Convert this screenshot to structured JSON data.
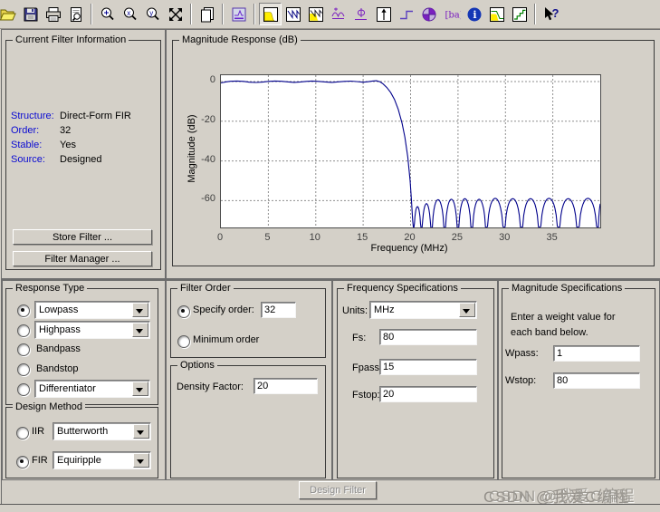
{
  "toolbar": {
    "icons": [
      "open",
      "save",
      "print",
      "print-preview",
      "zoom-in",
      "zoom-x",
      "zoom-y",
      "full-view",
      "print-to-figure",
      "filter-design",
      "magnitude-response",
      "phase-response",
      "magnitude-and-phase",
      "group-delay",
      "phase-delay",
      "impulse-response",
      "step-response",
      "pole-zero",
      "filter-coefficients",
      "filter-information",
      "magnitude-response-estimate",
      "realize-model",
      "help"
    ],
    "active_icon": "magnitude-response"
  },
  "current_filter_info": {
    "title": "Current Filter Information",
    "fields": [
      {
        "label": "Structure:",
        "value": "Direct-Form FIR"
      },
      {
        "label": "Order:",
        "value": "32"
      },
      {
        "label": "Stable:",
        "value": "Yes"
      },
      {
        "label": "Source:",
        "value": "Designed"
      }
    ],
    "store_filter_button": "Store Filter ...",
    "filter_manager_button": "Filter Manager ..."
  },
  "chart_data": {
    "type": "line",
    "title": "Magnitude Response (dB)",
    "xlabel": "Frequency (MHz)",
    "ylabel": "Magnitude (dB)",
    "xlim": [
      0,
      40
    ],
    "ylim": [
      -73.5,
      3.2
    ],
    "xticks": [
      0,
      5,
      10,
      15,
      20,
      25,
      30,
      35
    ],
    "yticks": [
      0,
      -20,
      -40,
      -60
    ],
    "grid": true,
    "line_color": "#00008b",
    "passband": [
      [
        0,
        -0.7
      ],
      [
        0.5,
        -0.2
      ],
      [
        1,
        0.15
      ],
      [
        1.7,
        0.3
      ],
      [
        2.4,
        0.1
      ],
      [
        3,
        -0.3
      ],
      [
        3.7,
        -0.45
      ],
      [
        4.4,
        -0.25
      ],
      [
        5,
        0.1
      ],
      [
        5.7,
        0.3
      ],
      [
        6.4,
        0.15
      ],
      [
        7,
        -0.15
      ],
      [
        7.7,
        -0.4
      ],
      [
        8.4,
        -0.2
      ],
      [
        9,
        0.1
      ],
      [
        9.6,
        0.3
      ],
      [
        10.3,
        0.1
      ],
      [
        11,
        -0.2
      ],
      [
        11.7,
        -0.4
      ],
      [
        12.4,
        -0.15
      ],
      [
        13,
        0.1
      ],
      [
        13.7,
        0.25
      ],
      [
        14.3,
        0
      ],
      [
        15,
        -0.3
      ],
      [
        15.5,
        -0.1
      ],
      [
        16,
        0.3
      ],
      [
        16.4,
        0.4
      ]
    ],
    "transition": [
      [
        16.8,
        -0.2
      ],
      [
        17.1,
        -1.2
      ],
      [
        17.5,
        -3
      ],
      [
        17.9,
        -5.5
      ],
      [
        18.3,
        -9
      ],
      [
        18.7,
        -14
      ],
      [
        19.1,
        -21
      ],
      [
        19.4,
        -28
      ],
      [
        19.7,
        -38
      ],
      [
        19.95,
        -50
      ],
      [
        20.1,
        -60
      ],
      [
        20.22,
        -70
      ],
      [
        20.3,
        -73.5
      ]
    ],
    "stopband_lobes": [
      [
        20.3,
        20.75,
        -63,
        21.15
      ],
      [
        21.15,
        21.65,
        -61.5,
        22.2
      ],
      [
        22.2,
        22.9,
        -59.5,
        23.6
      ],
      [
        23.6,
        24.3,
        -59.3,
        25.0
      ],
      [
        25.0,
        25.7,
        -59,
        26.45
      ],
      [
        26.45,
        27.2,
        -59.3,
        28.0
      ],
      [
        28.0,
        28.9,
        -58.8,
        29.85
      ],
      [
        29.85,
        30.75,
        -59,
        31.7
      ],
      [
        31.7,
        32.65,
        -59,
        33.6
      ],
      [
        33.6,
        34.6,
        -58.8,
        35.6
      ],
      [
        35.6,
        36.65,
        -59,
        37.65
      ],
      [
        37.65,
        38.7,
        -58.8,
        39.75
      ],
      [
        39.75,
        40.0,
        -60,
        40.55
      ]
    ]
  },
  "response_type": {
    "title": "Response Type",
    "options": [
      {
        "label": "Lowpass",
        "selected": true,
        "dropdown": true
      },
      {
        "label": "Highpass",
        "selected": false,
        "dropdown": true
      },
      {
        "label": "Bandpass",
        "selected": false,
        "dropdown": false
      },
      {
        "label": "Bandstop",
        "selected": false,
        "dropdown": false
      },
      {
        "label": "Differentiator",
        "selected": false,
        "dropdown": true
      }
    ]
  },
  "design_method": {
    "title": "Design Method",
    "iir": {
      "label": "IIR",
      "selected": false,
      "value": "Butterworth"
    },
    "fir": {
      "label": "FIR",
      "selected": true,
      "value": "Equiripple"
    }
  },
  "filter_order": {
    "title": "Filter Order",
    "specify_label": "Specify order:",
    "specify_value": "32",
    "specify_selected": true,
    "minimum_label": "Minimum order",
    "minimum_selected": false
  },
  "options_panel": {
    "title": "Options",
    "density_label": "Density Factor:",
    "density_value": "20"
  },
  "frequency_specs": {
    "title": "Frequency Specifications",
    "units_label": "Units:",
    "units_value": "MHz",
    "fs_label": "Fs:",
    "fs_value": "80",
    "fpass_label": "Fpass:",
    "fpass_value": "15",
    "fstop_label": "Fstop:",
    "fstop_value": "20"
  },
  "magnitude_specs": {
    "title": "Magnitude Specifications",
    "note_line1": "Enter a weight value for",
    "note_line2": "each band below.",
    "wpass_label": "Wpass:",
    "wpass_value": "1",
    "wstop_label": "Wstop:",
    "wstop_value": "80"
  },
  "design_filter_button": "Design Filter",
  "watermark": "CSDN @我爱C编程"
}
